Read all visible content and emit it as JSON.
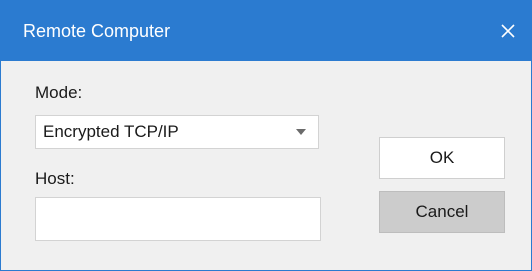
{
  "window": {
    "title": "Remote Computer",
    "accent_color": "#2b7bd0",
    "close_icon": "close-icon"
  },
  "form": {
    "mode_label": "Mode:",
    "mode_selected": "Encrypted TCP/IP",
    "host_label": "Host:",
    "host_value": ""
  },
  "buttons": {
    "ok_label": "OK",
    "cancel_label": "Cancel"
  }
}
